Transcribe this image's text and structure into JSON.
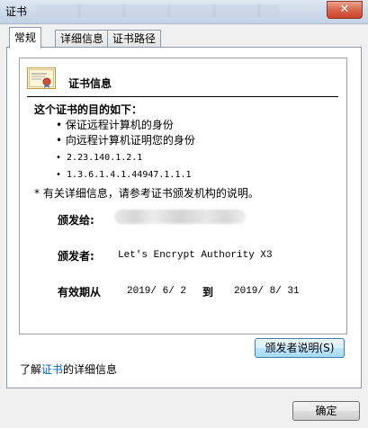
{
  "window": {
    "title": "证书",
    "close_glyph": "✕"
  },
  "tabs": [
    {
      "label": "常规",
      "active": true
    },
    {
      "label": "详细信息",
      "active": false
    },
    {
      "label": "证书路径",
      "active": false
    }
  ],
  "certificate": {
    "icon": "certificate-icon",
    "heading": "证书信息",
    "purpose_title": "这个证书的目的如下：",
    "purposes": [
      "• 保证远程计算机的身份",
      "• 向远程计算机证明您的身份",
      "• 2.23.140.1.2.1",
      "• 1.3.6.1.4.1.44947.1.1.1"
    ],
    "note": "* 有关详细信息，请参考证书颁发机构的说明。",
    "issued_to_label": "颁发给:",
    "issued_by_label": "颁发者:",
    "issued_by": "Let's Encrypt Authority X3",
    "valid_label": "有效期从",
    "valid_from": "2019/ 6/ 2",
    "valid_to_word": "到",
    "valid_to": "2019/ 8/ 31"
  },
  "buttons": {
    "issuer_statement": "颁发者说明(S)",
    "ok": "确定"
  },
  "learn_more": {
    "prefix": "了解",
    "link": "证书",
    "suffix": "的详细信息"
  },
  "colors": {
    "link": "#0066cc",
    "close_button": "#c8432a",
    "selected_button_border": "#3c7fb1"
  }
}
